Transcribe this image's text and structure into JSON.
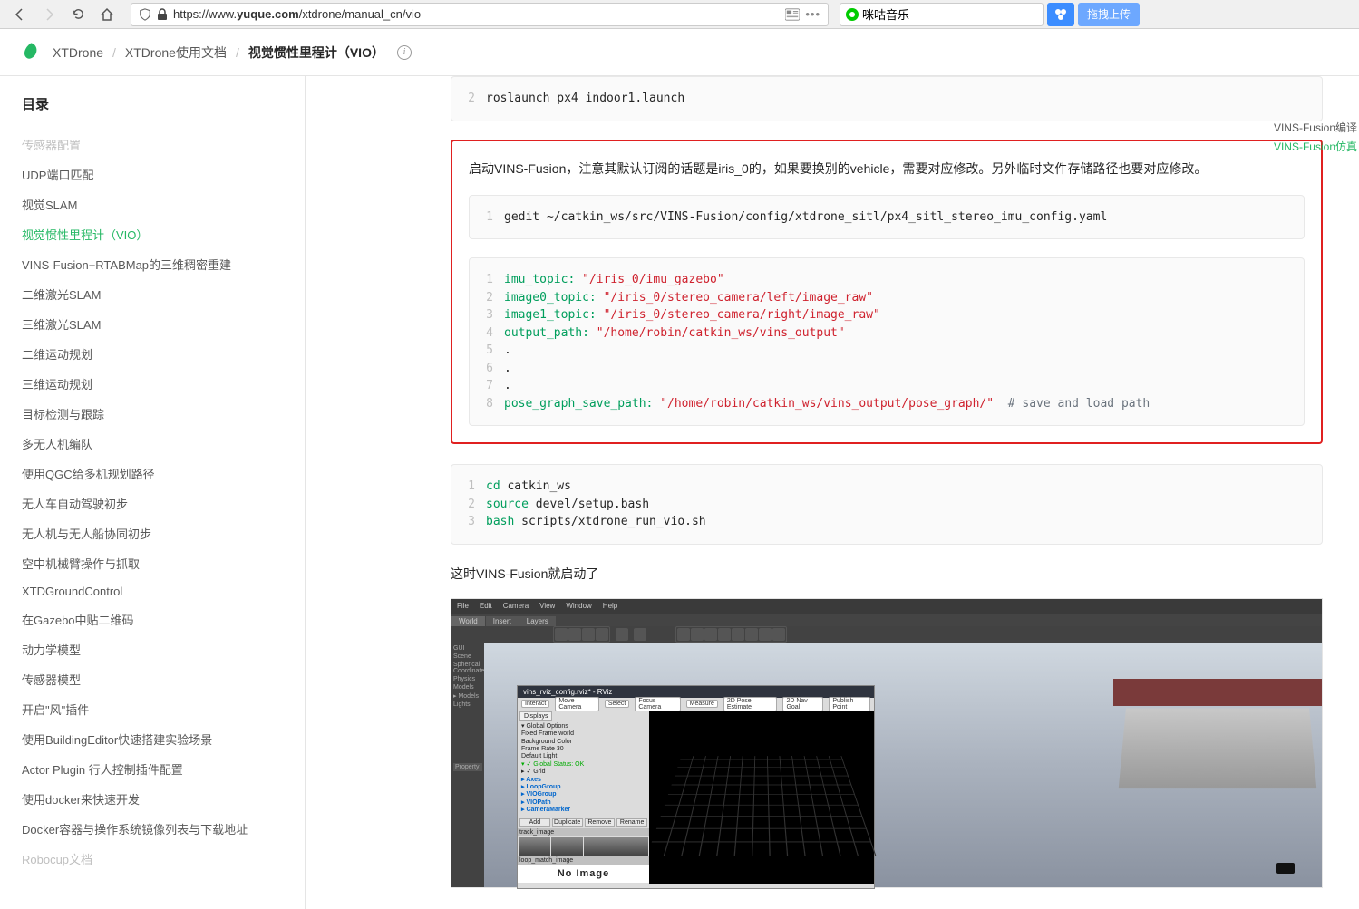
{
  "browser": {
    "url_prefix": "https://www.",
    "url_domain": "yuque.com",
    "url_path": "/xtdrone/manual_cn/vio",
    "search_value": "咪咕音乐",
    "upload_label": "拖拽上传"
  },
  "header": {
    "breadcrumb": [
      "XTDrone",
      "XTDrone使用文档"
    ],
    "current": "视觉惯性里程计（VIO）"
  },
  "sidebar": {
    "title": "目录",
    "items": [
      {
        "label": "传感器配置",
        "cls": "disabled"
      },
      {
        "label": "UDP端口匹配",
        "cls": ""
      },
      {
        "label": "视觉SLAM",
        "cls": ""
      },
      {
        "label": "视觉惯性里程计（VIO）",
        "cls": "active"
      },
      {
        "label": "VINS-Fusion+RTABMap的三维稠密重建",
        "cls": ""
      },
      {
        "label": "二维激光SLAM",
        "cls": ""
      },
      {
        "label": "三维激光SLAM",
        "cls": ""
      },
      {
        "label": "二维运动规划",
        "cls": ""
      },
      {
        "label": "三维运动规划",
        "cls": ""
      },
      {
        "label": "目标检测与跟踪",
        "cls": ""
      },
      {
        "label": "多无人机编队",
        "cls": ""
      },
      {
        "label": "使用QGC给多机规划路径",
        "cls": ""
      },
      {
        "label": "无人车自动驾驶初步",
        "cls": ""
      },
      {
        "label": "无人机与无人船协同初步",
        "cls": ""
      },
      {
        "label": "空中机械臂操作与抓取",
        "cls": ""
      },
      {
        "label": "XTDGroundControl",
        "cls": ""
      },
      {
        "label": "在Gazebo中贴二维码",
        "cls": ""
      },
      {
        "label": "动力学模型",
        "cls": ""
      },
      {
        "label": "传感器模型",
        "cls": ""
      },
      {
        "label": "开启\"风\"插件",
        "cls": ""
      },
      {
        "label": "使用BuildingEditor快速搭建实验场景",
        "cls": ""
      },
      {
        "label": "Actor Plugin 行人控制插件配置",
        "cls": ""
      },
      {
        "label": "使用docker来快速开发",
        "cls": ""
      },
      {
        "label": "Docker容器与操作系统镜像列表与下载地址",
        "cls": ""
      },
      {
        "label": "Robocup文档",
        "cls": "faded"
      }
    ]
  },
  "right_nav": [
    {
      "label": "VINS-Fusion编译",
      "active": false
    },
    {
      "label": "VINS-Fusion仿真",
      "active": true
    }
  ],
  "content": {
    "code1_line": "roslaunch px4 indoor1.launch",
    "para1": "启动VINS-Fusion，注意其默认订阅的话题是iris_0的，如果要换别的vehicle，需要对应修改。另外临时文件存储路径也要对应修改。",
    "code2_line": "gedit ~/catkin_ws/src/VINS-Fusion/config/xtdrone_sitl/px4_sitl_stereo_imu_config.yaml",
    "yaml": {
      "l1": {
        "key": "imu_topic:",
        "val": "\"/iris_0/imu_gazebo\""
      },
      "l2": {
        "key": "image0_topic:",
        "val": "\"/iris_0/stereo_camera/left/image_raw\""
      },
      "l3": {
        "key": "image1_topic:",
        "val": "\"/iris_0/stereo_camera/right/image_raw\""
      },
      "l4": {
        "key": "output_path:",
        "val": "\"/home/robin/catkin_ws/vins_output\""
      },
      "l5": ".",
      "l6": ".",
      "l7": ".",
      "l8": {
        "key": "pose_graph_save_path:",
        "val": "\"/home/robin/catkin_ws/vins_output/pose_graph/\"",
        "comment": "  # save and load path"
      }
    },
    "code3": {
      "l1": {
        "text": "cd",
        "rest": " catkin_ws"
      },
      "l2": {
        "text": "source",
        "rest": " devel/setup.bash"
      },
      "l3": {
        "text": "bash",
        "rest": " scripts/xtdrone_run_vio.sh"
      }
    },
    "para2": "这时VINS-Fusion就启动了"
  },
  "embedded": {
    "menubar": [
      "File",
      "Edit",
      "Camera",
      "View",
      "Window",
      "Help"
    ],
    "tabs": [
      "World",
      "Insert",
      "Layers"
    ],
    "side": [
      "GUI",
      "Scene",
      "Spherical Coordinates",
      "Physics",
      "Models",
      "▸ Models",
      "Lights"
    ],
    "rviz_title": "vins_rviz_config.rviz* - RViz",
    "rviz_tools": [
      "Interact",
      "Move Camera",
      "Select",
      "Focus Camera",
      "Measure",
      "2D Pose Estimate",
      "2D Nav Goal",
      "Publish Point"
    ],
    "rviz_displays": "Displays",
    "rviz_tree": [
      {
        "t": "▾ Global Options",
        "cls": ""
      },
      {
        "t": "   Fixed Frame        world",
        "cls": ""
      },
      {
        "t": "   Background Color",
        "cls": ""
      },
      {
        "t": "   Frame Rate           30",
        "cls": ""
      },
      {
        "t": "   Default Light",
        "cls": ""
      },
      {
        "t": "▾ ✓ Global Status: OK",
        "cls": "green"
      },
      {
        "t": "▸ ✓ Grid",
        "cls": ""
      },
      {
        "t": "▸ Axes",
        "cls": "blue"
      },
      {
        "t": "▸ LoopGroup",
        "cls": "blue"
      },
      {
        "t": "▸ VIOGroup",
        "cls": "blue"
      },
      {
        "t": "  ▸ VIOPath",
        "cls": "blue"
      },
      {
        "t": "  ▸ CameraMarker",
        "cls": "blue"
      }
    ],
    "rviz_btns": [
      "Add",
      "Duplicate",
      "Remove",
      "Rename"
    ],
    "property": "Property",
    "thumb1": "track_image",
    "thumb2": "loop_match_image",
    "noimage": "No Image"
  }
}
